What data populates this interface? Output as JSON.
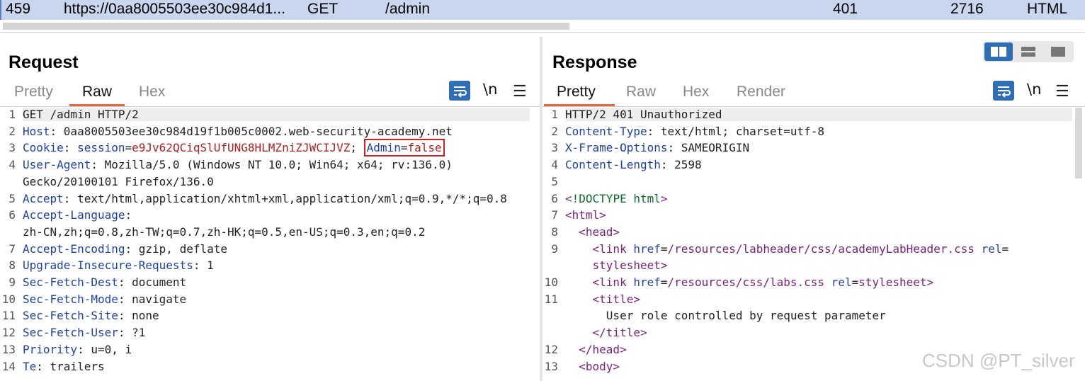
{
  "history": {
    "id": "459",
    "url": "https://0aa8005503ee30c984d1...",
    "method": "GET",
    "path": "/admin",
    "status": "401",
    "length": "2716",
    "mime": "HTML"
  },
  "request": {
    "title": "Request",
    "tabs": [
      "Pretty",
      "Raw",
      "Hex"
    ],
    "active_tab": "Raw",
    "wrap_icon": "wrap-icon",
    "newline_label": "\\n",
    "menu_label": "☰",
    "lines": [
      {
        "n": "1",
        "key": "GET /admin HTTP/2",
        "val": ""
      },
      {
        "n": "2",
        "key": "Host",
        "val": ": 0aa8005503ee30c984d19f1b005c0002.web-security-academy.net"
      },
      {
        "n": "3",
        "key": "Cookie",
        "sep": ": ",
        "cookie_name": "session",
        "cookie_eq": "=",
        "cookie_val": "e9Jv62QCiqSlUfUNG8HLMZniZJWCIJVZ",
        "semi": "; ",
        "admin_name": "Admin",
        "admin_eq": "=",
        "admin_val": "false"
      },
      {
        "n": "4",
        "key": "User-Agent",
        "val": ": Mozilla/5.0 (Windows NT 10.0; Win64; x64; rv:136.0)"
      },
      {
        "n": "",
        "key": "",
        "val": "Gecko/20100101 Firefox/136.0"
      },
      {
        "n": "5",
        "key": "Accept",
        "val": ": text/html,application/xhtml+xml,application/xml;q=0.9,*/*;q=0.8"
      },
      {
        "n": "6",
        "key": "Accept-Language",
        "val": ":"
      },
      {
        "n": "",
        "key": "",
        "val": "zh-CN,zh;q=0.8,zh-TW;q=0.7,zh-HK;q=0.5,en-US;q=0.3,en;q=0.2"
      },
      {
        "n": "7",
        "key": "Accept-Encoding",
        "val": ": gzip, deflate"
      },
      {
        "n": "8",
        "key": "Upgrade-Insecure-Requests",
        "val": ": 1"
      },
      {
        "n": "9",
        "key": "Sec-Fetch-Dest",
        "val": ": document"
      },
      {
        "n": "10",
        "key": "Sec-Fetch-Mode",
        "val": ": navigate"
      },
      {
        "n": "11",
        "key": "Sec-Fetch-Site",
        "val": ": none"
      },
      {
        "n": "12",
        "key": "Sec-Fetch-User",
        "val": ": ?1"
      },
      {
        "n": "13",
        "key": "Priority",
        "val": ": u=0, i"
      },
      {
        "n": "14",
        "key": "Te",
        "val": ": trailers"
      }
    ]
  },
  "response": {
    "title": "Response",
    "tabs": [
      "Pretty",
      "Raw",
      "Hex",
      "Render"
    ],
    "active_tab": "Pretty",
    "wrap_icon": "wrap-icon",
    "newline_label": "\\n",
    "menu_label": "☰",
    "layout_icons": [
      "split-columns-icon",
      "split-rows-icon",
      "single-pane-icon"
    ],
    "lines": [
      {
        "n": "1",
        "parts": [
          [
            "v",
            "HTTP/2 401 Unauthorized"
          ]
        ]
      },
      {
        "n": "2",
        "parts": [
          [
            "k",
            "Content-Type"
          ],
          [
            "v",
            ": text/html; charset=utf-8"
          ]
        ]
      },
      {
        "n": "3",
        "parts": [
          [
            "k",
            "X-Frame-Options"
          ],
          [
            "v",
            ": SAMEORIGIN"
          ]
        ]
      },
      {
        "n": "4",
        "parts": [
          [
            "k",
            "Content-Length"
          ],
          [
            "v",
            ": 2598"
          ]
        ]
      },
      {
        "n": "5",
        "parts": []
      },
      {
        "n": "6",
        "parts": [
          [
            "tag",
            "<"
          ],
          [
            "dt",
            "!DOCTYPE html"
          ],
          [
            "tag",
            ">"
          ]
        ]
      },
      {
        "n": "7",
        "parts": [
          [
            "tag",
            "<html>"
          ]
        ]
      },
      {
        "n": "8",
        "parts": [
          [
            "v",
            "  "
          ],
          [
            "tag",
            "<head>"
          ]
        ]
      },
      {
        "n": "9",
        "parts": [
          [
            "v",
            "    "
          ],
          [
            "tag",
            "<link "
          ],
          [
            "atr",
            "href"
          ],
          [
            "v",
            "="
          ],
          [
            "tag",
            "/resources/labheader/css/academyLabHeader.css "
          ],
          [
            "atr",
            "rel"
          ],
          [
            "v",
            "="
          ]
        ]
      },
      {
        "n": "",
        "parts": [
          [
            "v",
            "    "
          ],
          [
            "tag",
            "stylesheet>"
          ]
        ]
      },
      {
        "n": "10",
        "parts": [
          [
            "v",
            "    "
          ],
          [
            "tag",
            "<link "
          ],
          [
            "atr",
            "href"
          ],
          [
            "v",
            "="
          ],
          [
            "tag",
            "/resources/css/labs.css "
          ],
          [
            "atr",
            "rel"
          ],
          [
            "v",
            "="
          ],
          [
            "tag",
            "stylesheet>"
          ]
        ]
      },
      {
        "n": "11",
        "parts": [
          [
            "v",
            "    "
          ],
          [
            "tag",
            "<title>"
          ]
        ]
      },
      {
        "n": "",
        "parts": [
          [
            "v",
            "      User role controlled by request parameter"
          ]
        ]
      },
      {
        "n": "",
        "parts": [
          [
            "v",
            "    "
          ],
          [
            "tag",
            "</title>"
          ]
        ]
      },
      {
        "n": "12",
        "parts": [
          [
            "v",
            "  "
          ],
          [
            "tag",
            "</head>"
          ]
        ]
      },
      {
        "n": "13",
        "parts": [
          [
            "v",
            "  "
          ],
          [
            "tag",
            "<body>"
          ]
        ]
      }
    ]
  },
  "watermark": "CSDN @PT_silver",
  "colors": {
    "accent": "#e8643b",
    "selected_row": "#c8d6ee",
    "tool_blue": "#2f6db5"
  }
}
